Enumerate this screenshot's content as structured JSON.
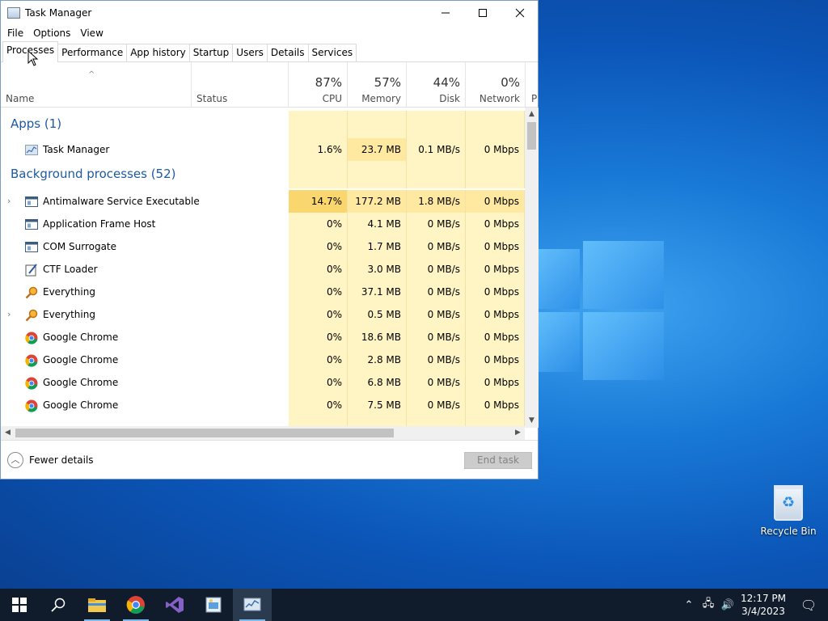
{
  "window": {
    "title": "Task Manager",
    "menu": [
      "File",
      "Options",
      "View"
    ],
    "tabs": [
      "Processes",
      "Performance",
      "App history",
      "Startup",
      "Users",
      "Details",
      "Services"
    ],
    "active_tab": "Processes"
  },
  "columns": {
    "name": "Name",
    "status": "Status",
    "cpu": {
      "pct": "87%",
      "label": "CPU"
    },
    "memory": {
      "pct": "57%",
      "label": "Memory"
    },
    "disk": {
      "pct": "44%",
      "label": "Disk"
    },
    "network": {
      "pct": "0%",
      "label": "Network"
    },
    "power_partial": "P"
  },
  "groups": {
    "apps": "Apps (1)",
    "background": "Background processes (52)"
  },
  "apps": [
    {
      "name": "Task Manager",
      "icon": "task-manager-icon",
      "cpu": "1.6%",
      "memory": "23.7 MB",
      "disk": "0.1 MB/s",
      "network": "0 Mbps"
    }
  ],
  "background": [
    {
      "name": "Antimalware Service Executable",
      "icon": "window-icon",
      "expandable": true,
      "cpu": "14.7%",
      "memory": "177.2 MB",
      "disk": "1.8 MB/s",
      "network": "0 Mbps"
    },
    {
      "name": "Application Frame Host",
      "icon": "window-icon",
      "cpu": "0%",
      "memory": "4.1 MB",
      "disk": "0 MB/s",
      "network": "0 Mbps"
    },
    {
      "name": "COM Surrogate",
      "icon": "window-icon",
      "cpu": "0%",
      "memory": "1.7 MB",
      "disk": "0 MB/s",
      "network": "0 Mbps"
    },
    {
      "name": "CTF Loader",
      "icon": "pen-icon",
      "cpu": "0%",
      "memory": "3.0 MB",
      "disk": "0 MB/s",
      "network": "0 Mbps"
    },
    {
      "name": "Everything",
      "icon": "magnifier-icon",
      "cpu": "0%",
      "memory": "37.1 MB",
      "disk": "0 MB/s",
      "network": "0 Mbps"
    },
    {
      "name": "Everything",
      "icon": "magnifier-icon",
      "expandable": true,
      "cpu": "0%",
      "memory": "0.5 MB",
      "disk": "0 MB/s",
      "network": "0 Mbps"
    },
    {
      "name": "Google Chrome",
      "icon": "chrome-icon",
      "cpu": "0%",
      "memory": "18.6 MB",
      "disk": "0 MB/s",
      "network": "0 Mbps"
    },
    {
      "name": "Google Chrome",
      "icon": "chrome-icon",
      "cpu": "0%",
      "memory": "2.8 MB",
      "disk": "0 MB/s",
      "network": "0 Mbps"
    },
    {
      "name": "Google Chrome",
      "icon": "chrome-icon",
      "cpu": "0%",
      "memory": "6.8 MB",
      "disk": "0 MB/s",
      "network": "0 Mbps"
    },
    {
      "name": "Google Chrome",
      "icon": "chrome-icon",
      "cpu": "0%",
      "memory": "7.5 MB",
      "disk": "0 MB/s",
      "network": "0 Mbps"
    }
  ],
  "footer": {
    "fewer_details": "Fewer details",
    "end_task": "End task"
  },
  "desktop": {
    "recycle_bin": "Recycle Bin"
  },
  "taskbar": {
    "time": "12:17 PM",
    "date": "3/4/2023",
    "apps": [
      "start-icon",
      "search-icon",
      "file-explorer-icon",
      "chrome-icon",
      "visual-studio-icon",
      "paint-icon",
      "task-manager-icon"
    ]
  },
  "colors": {
    "cpu_heat_light": "#fff4c4",
    "cpu_heat_mid": "#ffe9a0",
    "cpu_heat_strong": "#f9d66e",
    "group_text": "#1e5aa0",
    "taskbar": "#101c2c"
  }
}
